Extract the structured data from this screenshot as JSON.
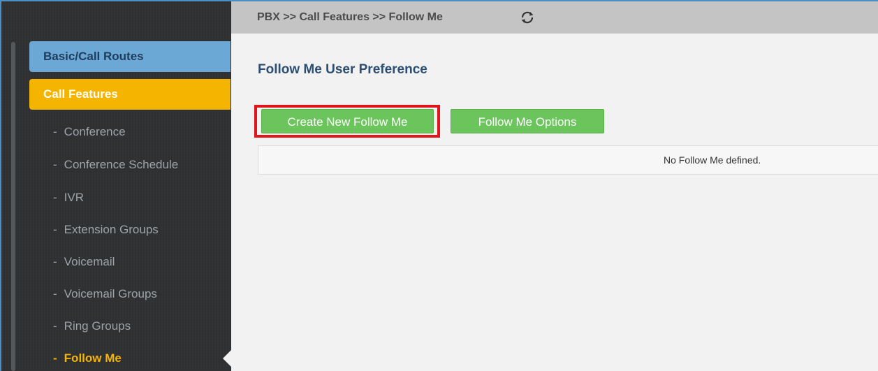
{
  "breadcrumb": "PBX >> Call Features >> Follow Me",
  "sidebar": {
    "basic_label": "Basic/Call Routes",
    "features_label": "Call Features",
    "items": [
      {
        "label": "Conference"
      },
      {
        "label": "Conference Schedule"
      },
      {
        "label": "IVR"
      },
      {
        "label": "Extension Groups"
      },
      {
        "label": "Voicemail"
      },
      {
        "label": "Voicemail Groups"
      },
      {
        "label": "Ring Groups"
      },
      {
        "label": "Follow Me"
      }
    ],
    "item_prefix": "-"
  },
  "main": {
    "title": "Follow Me User Preference",
    "create_button": "Create New Follow Me",
    "options_button": "Follow Me Options",
    "empty_message": "No Follow Me defined."
  },
  "colors": {
    "active_nav": "#f5b400",
    "button_green": "#6cc45c",
    "highlight_red": "#e0161d"
  },
  "icons": {
    "refresh": "refresh-icon"
  }
}
